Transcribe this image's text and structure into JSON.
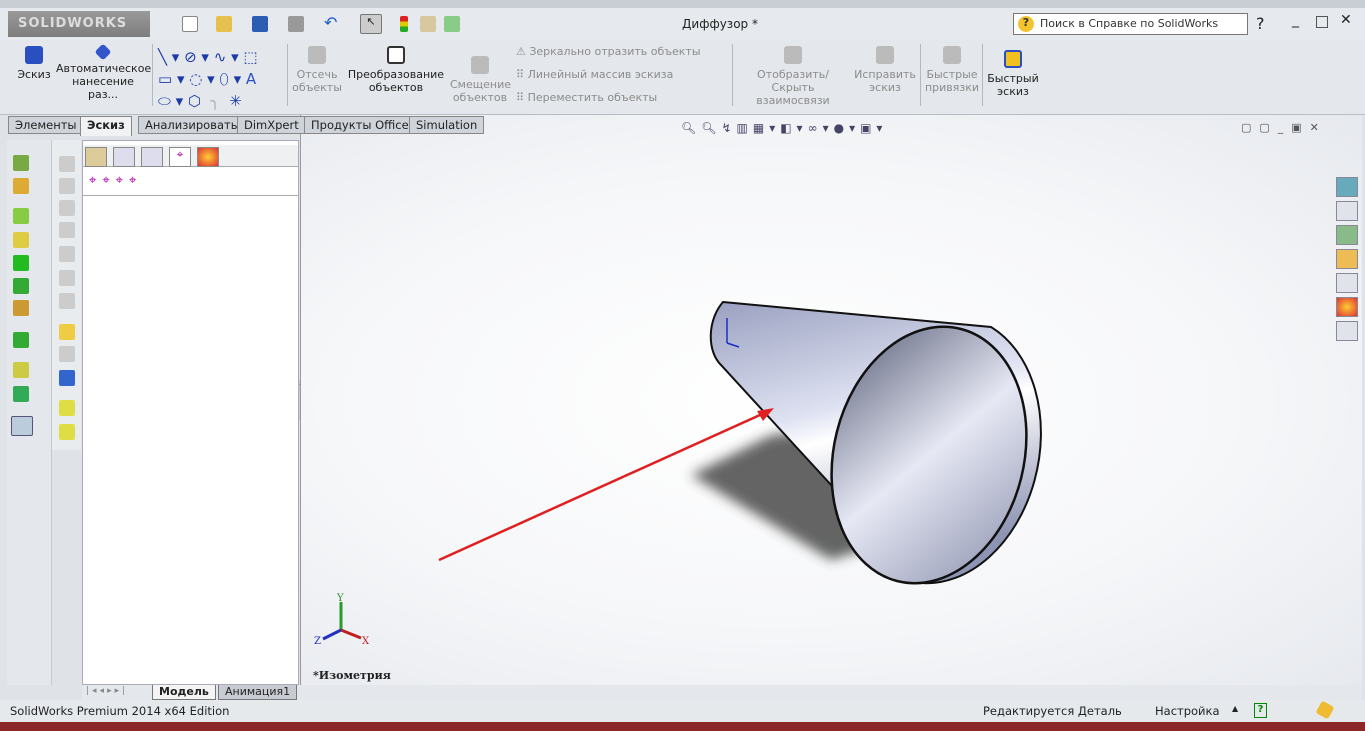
{
  "app": {
    "logo": "SOLIDWORKS",
    "title": "Диффузор *",
    "search_placeholder": "Поиск в Справке по SolidWorks"
  },
  "ribbon": {
    "sketch": "Эскиз",
    "smart_dim": "Автоматическое нанесение раз...",
    "trim": "Отсечь объекты",
    "convert": "Преобразование объектов",
    "offset": "Смещение объектов",
    "mirror": "Зеркально отразить объекты",
    "linear_pattern": "Линейный массив эскиза",
    "move": "Переместить объекты",
    "relations": "Отобразить/Скрыть взаимосвязи",
    "repair": "Исправить эскиз",
    "snaps": "Быстрые привязки",
    "rapid": "Быстрый эскиз"
  },
  "tabs": [
    "Элементы",
    "Эскиз",
    "Анализировать",
    "DimXpert",
    "Продукты Office",
    "Simulation"
  ],
  "active_tab": "Эскиз",
  "viewport": {
    "view_name": "*Изометрия",
    "axes": {
      "x": "X",
      "y": "Y",
      "z": "Z"
    }
  },
  "bottom_tabs": [
    "Модель",
    "Анимация1"
  ],
  "status": {
    "edition": "SolidWorks Premium 2014 x64 Edition",
    "mode": "Редактируется Деталь",
    "custom": "Настройка"
  },
  "colors": {
    "arrow": "#e02020",
    "cone": "#b8bdd6"
  }
}
